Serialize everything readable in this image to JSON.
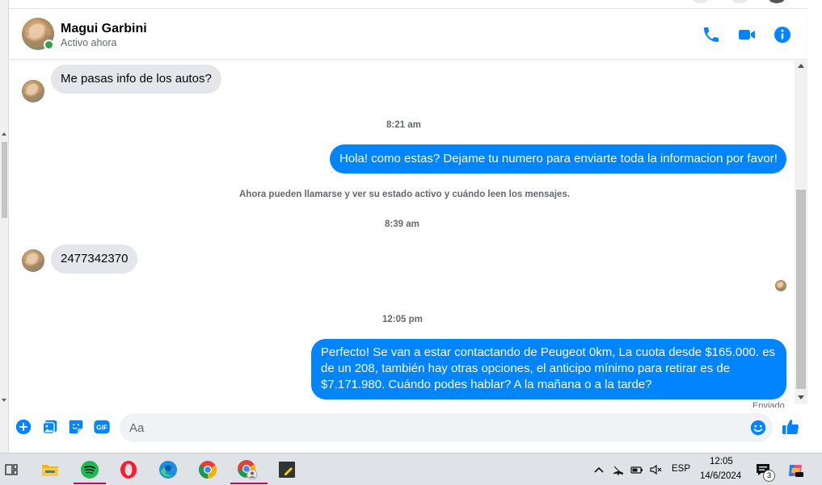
{
  "header": {
    "contact_name": "Magui Garbini",
    "status": "Activo ahora",
    "icons": [
      "phone-icon",
      "video-camera-icon",
      "info-icon"
    ]
  },
  "messages": [
    {
      "direction": "in",
      "text": "Me pasas info de los autos?"
    },
    {
      "type": "timestamp",
      "text": "8:21 am"
    },
    {
      "direction": "out",
      "text": "Hola! como estas? Dejame tu numero para enviarte toda la informacion por favor!"
    },
    {
      "type": "system",
      "text": "Ahora pueden llamarse y ver su estado activo y cuándo leen los mensajes."
    },
    {
      "type": "timestamp",
      "text": "8:39 am"
    },
    {
      "direction": "in",
      "text": "2477342370"
    },
    {
      "type": "timestamp",
      "text": "12:05 pm"
    },
    {
      "direction": "out",
      "text": "Perfecto!  Se van a estar contactando de Peugeot 0km, La cuota desde $165.000. es de un 208, también hay otras opciones, el anticipo mínimo para retirar es de $7.171.980. Cuándo podes hablar? A la mañana o a la tarde?"
    }
  ],
  "sent_status": "Enviado",
  "composer": {
    "placeholder": "Aa",
    "icons": [
      "plus-circle-icon",
      "image-icon",
      "sticker-icon",
      "gif-icon",
      "emoji-icon",
      "thumbs-up-icon"
    ],
    "gif_label": "GIF"
  },
  "taskbar": {
    "apps": [
      "task-view-icon",
      "file-explorer-icon",
      "spotify-icon",
      "opera-icon",
      "edge-icon",
      "chrome-icon",
      "chrome-profile-icon",
      "sticky-notes-icon"
    ],
    "language": "ESP",
    "time": "12:05",
    "date": "14/6/2024",
    "notification_count": "3"
  },
  "colors": {
    "accent": "#0084ff",
    "incoming_bubble": "#e4e6eb",
    "online": "#31a24c",
    "taskbar": "#dfe3e8"
  }
}
